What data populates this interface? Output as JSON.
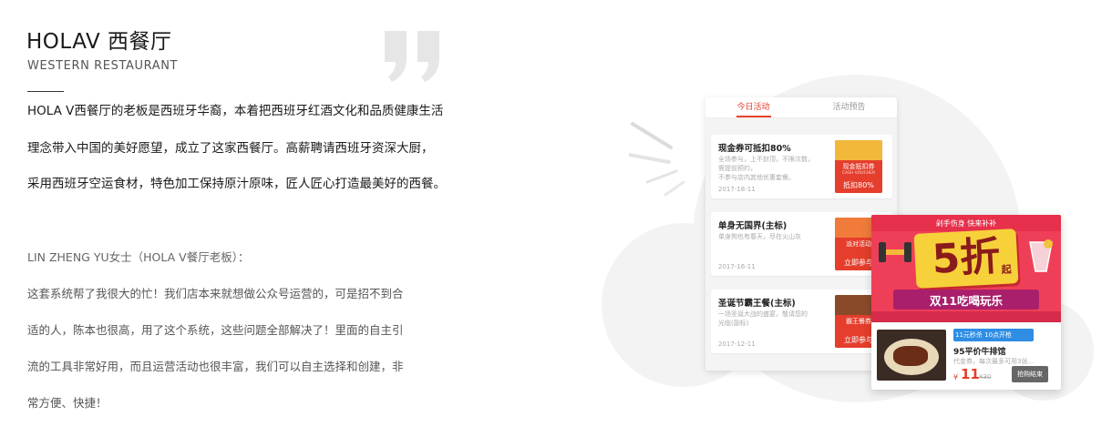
{
  "header": {
    "title": "HOLAV 西餐厅",
    "subtitle": "WESTERN RESTAURANT"
  },
  "story": [
    "HOLA V西餐厅的老板是西班牙华裔，本着把西班牙红酒文化和品质健康生活",
    "理念带入中国的美好愿望，成立了这家西餐厅。高薪聘请西班牙资深大厨，",
    "采用西班牙空运食材，特色加工保持原汁原味，匠人匠心打造最美好的西餐。"
  ],
  "testimonial": {
    "author": "LIN ZHENG YU女士（HOLA V餐厅老板）：",
    "lines": [
      "这套系统帮了我很大的忙！我们店本来就想做公众号运营的，可是招不到合",
      "适的人，陈本也很高，用了这个系统，这些问题全部解决了！里面的自主引",
      "流的工具非常好用，而且运营活动也很丰富，我们可以自主选择和创建，非",
      "常方便、快捷！"
    ]
  },
  "phone": {
    "tabs": [
      "今日活动",
      "活动预告"
    ],
    "cards": [
      {
        "title": "现金券可抵扣80%",
        "desc": [
          "全场参与，上不封顶，不限次数，",
          "需提前预约，",
          "不参与店内其他优惠套餐。"
        ],
        "date": "2017-18-11",
        "badge_title": "现金抵扣券",
        "badge_sub": "CASH VOUCHER",
        "badge_action": "抵扣80%"
      },
      {
        "title": "单身无国界(主标)",
        "desc": [
          "单身狗也有春天，尽在火山灰"
        ],
        "date": "2017-16-11",
        "badge_title": "派对活动",
        "badge_sub": "",
        "badge_action": "立即参与"
      },
      {
        "title": "圣诞节霸王餐(主标)",
        "desc": [
          "一场圣诞大战的盛宴，敬请您的",
          "光临(副标)"
        ],
        "date": "2017-12-11",
        "badge_title": "霸王餐券",
        "badge_sub": "",
        "badge_action": "立即参与"
      }
    ]
  },
  "promo": {
    "header": "剁手伤身 快来补补",
    "discount": "5折",
    "discount_suffix": "起",
    "slogan": "双11吃喝玩乐",
    "deal_tag": "11元秒杀 10点开枪",
    "deal_title": "95平价牛排馆",
    "deal_desc": "代金券，每次最多可用3张...",
    "currency": "¥",
    "price": "11",
    "old_price": "¥30",
    "button": "抢购结束"
  },
  "colors": {
    "accent": "#e53e2c",
    "promo_red": "#ef3f58",
    "promo_yellow": "#f7d13a",
    "tag_blue": "#2f8de4"
  }
}
